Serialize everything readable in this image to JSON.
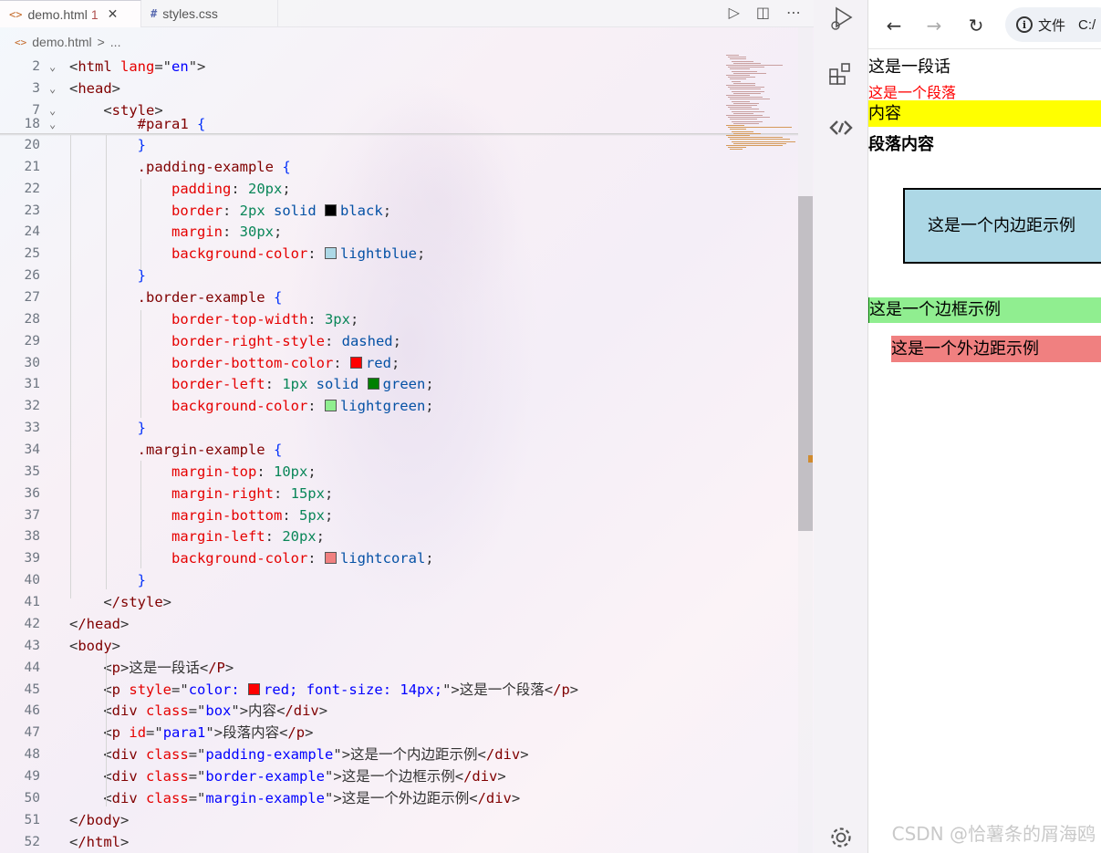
{
  "editor": {
    "tabs": [
      {
        "icon": "<>",
        "label": "demo.html",
        "badge": "1",
        "close": "✕"
      },
      {
        "icon": "#",
        "label": "styles.css"
      }
    ],
    "breadcrumb": {
      "icon": "<>",
      "file": "demo.html",
      "sep": ">",
      "more": "..."
    },
    "tab_actions": [
      "▷",
      "◫",
      "⋯"
    ],
    "sticky_lines": [
      {
        "n": "2",
        "text": "<html lang=\"en\">"
      },
      {
        "n": "3",
        "text": "<head>"
      },
      {
        "n": "7",
        "text": "    <style>"
      },
      {
        "n": "18",
        "text": "        #para1 {"
      }
    ],
    "lines": [
      {
        "n": "20",
        "text": "        }"
      },
      {
        "n": "21",
        "text": "        .padding-example {"
      },
      {
        "n": "22",
        "text": "            padding: 20px;"
      },
      {
        "n": "23",
        "text": "            border: 2px solid black;"
      },
      {
        "n": "24",
        "text": "            margin: 30px;"
      },
      {
        "n": "25",
        "text": "            background-color: lightblue;"
      },
      {
        "n": "26",
        "text": "        }"
      },
      {
        "n": "27",
        "text": "        .border-example {"
      },
      {
        "n": "28",
        "text": "            border-top-width: 3px;"
      },
      {
        "n": "29",
        "text": "            border-right-style: dashed;"
      },
      {
        "n": "30",
        "text": "            border-bottom-color: red;"
      },
      {
        "n": "31",
        "text": "            border-left: 1px solid green;"
      },
      {
        "n": "32",
        "text": "            background-color: lightgreen;"
      },
      {
        "n": "33",
        "text": "        }"
      },
      {
        "n": "34",
        "text": "        .margin-example {"
      },
      {
        "n": "35",
        "text": "            margin-top: 10px;"
      },
      {
        "n": "36",
        "text": "            margin-right: 15px;"
      },
      {
        "n": "37",
        "text": "            margin-bottom: 5px;"
      },
      {
        "n": "38",
        "text": "            margin-left: 20px;"
      },
      {
        "n": "39",
        "text": "            background-color: lightcoral;"
      },
      {
        "n": "40",
        "text": "        }"
      },
      {
        "n": "41",
        "text": "    </style>"
      },
      {
        "n": "42",
        "text": "</head>"
      },
      {
        "n": "43",
        "text": "<body>"
      },
      {
        "n": "44",
        "text": "    <p>这是一段话</P>"
      },
      {
        "n": "45",
        "text": "    <p style=\"color: red; font-size: 14px;\">这是一个段落</p>"
      },
      {
        "n": "46",
        "text": "    <div class=\"box\">内容</div>"
      },
      {
        "n": "47",
        "text": "    <p id=\"para1\">段落内容</p>"
      },
      {
        "n": "48",
        "text": "    <div class=\"padding-example\">这是一个内边距示例</div>"
      },
      {
        "n": "49",
        "text": "    <div class=\"border-example\">这是一个边框示例</div>"
      },
      {
        "n": "50",
        "text": "    <div class=\"margin-example\">这是一个外边距示例</div>"
      },
      {
        "n": "51",
        "text": "</body>"
      },
      {
        "n": "52",
        "text": "</html>"
      }
    ],
    "colors": {
      "black": "#000000",
      "lightblue": "#add8e6",
      "red": "#ff0000",
      "green": "#008000",
      "lightgreen": "#90ee90",
      "lightcoral": "#f08080"
    }
  },
  "activity_bar": {
    "icons": [
      "run-debug-icon",
      "extensions-icon",
      "remote-icon",
      "settings-gear-icon"
    ]
  },
  "browser": {
    "nav": {
      "back": "←",
      "forward": "→",
      "reload": "↻"
    },
    "address": {
      "info_icon": "i",
      "label": "文件",
      "path": "C:/"
    },
    "page": {
      "p1": "这是一段话",
      "p2": "这是一个段落",
      "box": "内容",
      "para1": "段落内容",
      "padding_example": "这是一个内边距示例",
      "border_example": "这是一个边框示例",
      "margin_example": "这是一个外边距示例"
    }
  },
  "watermark": "CSDN @恰薯条的屑海鸥"
}
